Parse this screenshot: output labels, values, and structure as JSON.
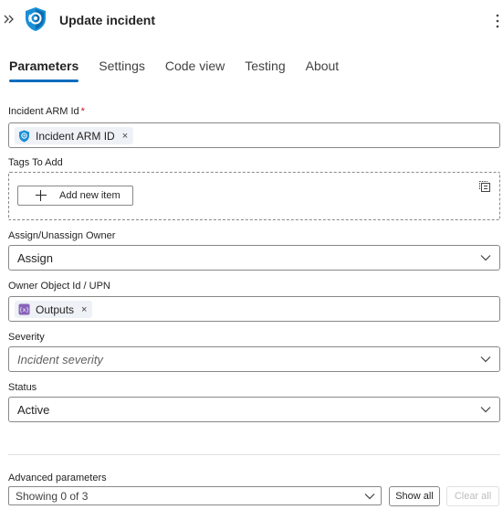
{
  "header": {
    "title": "Update incident",
    "expand_icon": "chevron-double-right-icon",
    "logo_icon": "sentinel-shield-icon",
    "more_icon": "more-vertical-icon"
  },
  "tabs": [
    {
      "label": "Parameters",
      "active": true
    },
    {
      "label": "Settings",
      "active": false
    },
    {
      "label": "Code view",
      "active": false
    },
    {
      "label": "Testing",
      "active": false
    },
    {
      "label": "About",
      "active": false
    }
  ],
  "fields": {
    "incident_arm_id": {
      "label": "Incident ARM Id",
      "required_mark": "*",
      "token": "Incident ARM ID",
      "token_icon": "sentinel-shield-icon",
      "remove": "×"
    },
    "tags_to_add": {
      "label": "Tags To Add",
      "add_button": "Add new item",
      "switch_icon": "array-toggle-icon"
    },
    "assign_owner": {
      "label": "Assign/Unassign Owner",
      "value": "Assign"
    },
    "owner_object_id": {
      "label": "Owner Object Id / UPN",
      "token": "Outputs",
      "token_icon": "outputs-icon",
      "remove": "×"
    },
    "severity": {
      "label": "Severity",
      "placeholder": "Incident severity"
    },
    "status": {
      "label": "Status",
      "value": "Active"
    }
  },
  "advanced": {
    "label": "Advanced parameters",
    "selected": "Showing 0 of 3",
    "show_all": "Show all",
    "clear_all": "Clear all"
  },
  "colors": {
    "accent": "#0f6cbd",
    "required": "#c50f1f",
    "outputs_token": "#8764b8",
    "sentinel": "#1a8fd6"
  }
}
